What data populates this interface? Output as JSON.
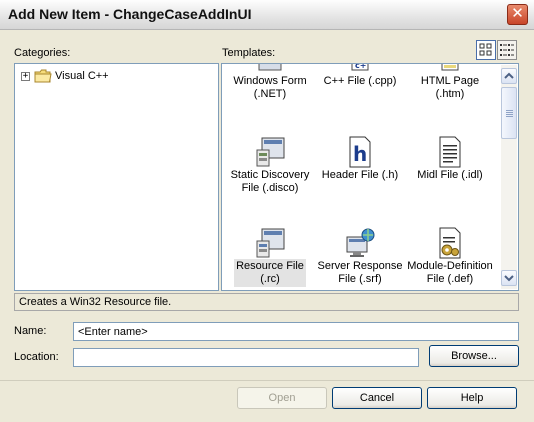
{
  "window": {
    "title": "Add New Item - ChangeCaseAddInUI",
    "close_glyph": "✕"
  },
  "categories": {
    "label": "Categories:",
    "tree": [
      {
        "label": "Visual C++",
        "expander": "+",
        "icon": "folder-icon"
      }
    ]
  },
  "templates": {
    "label": "Templates:",
    "view_buttons": [
      {
        "name": "large-icons-view-icon",
        "active": true
      },
      {
        "name": "small-icons-view-icon",
        "active": false
      }
    ],
    "items": [
      {
        "label_line1": "Windows Form",
        "label_line2": "(.NET)",
        "icon": "windows-form-icon"
      },
      {
        "label_line1": "C++ File (.cpp)",
        "label_line2": "",
        "icon": "cpp-file-icon"
      },
      {
        "label_line1": "HTML Page (.htm)",
        "label_line2": "",
        "icon": "html-page-icon"
      },
      {
        "label_line1": "Static Discovery",
        "label_line2": "File (.disco)",
        "icon": "static-discovery-icon"
      },
      {
        "label_line1": "Header File (.h)",
        "label_line2": "",
        "icon": "header-file-icon"
      },
      {
        "label_line1": "Midl File (.idl)",
        "label_line2": "",
        "icon": "midl-file-icon"
      },
      {
        "label_line1": "Resource File",
        "label_line2": "(.rc)",
        "icon": "resource-file-icon",
        "selected": true
      },
      {
        "label_line1": "Server Response",
        "label_line2": "File (.srf)",
        "icon": "server-response-icon"
      },
      {
        "label_line1": "Module-Definition",
        "label_line2": "File (.def)",
        "icon": "module-definition-icon"
      }
    ],
    "header_file_glyph": "h"
  },
  "status": {
    "description": "Creates a Win32 Resource file."
  },
  "form": {
    "name_label": "Name:",
    "name_value": "<Enter name>",
    "location_label": "Location:",
    "location_value": "",
    "browse_label": "Browse..."
  },
  "buttons": {
    "open": "Open",
    "cancel": "Cancel",
    "help": "Help"
  },
  "colors": {
    "accent": "#4a6ea9",
    "panel_border": "#7f9db9",
    "dialog_bg": "#ece9d8"
  }
}
